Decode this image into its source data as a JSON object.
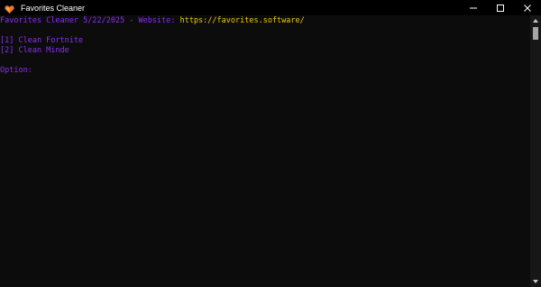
{
  "window": {
    "title": "Favorites Cleaner"
  },
  "console": {
    "header_prefix": "Favorites Cleaner 5/22/2025 - Website: ",
    "header_url": "https://favorites.software/",
    "options": [
      "[1] Clean Fortnite",
      "[2] Clean Minde"
    ],
    "prompt": "Option:"
  },
  "colors": {
    "background": "#0c0c0c",
    "text": "#8b2ff0",
    "url": "#f2c811",
    "titlebar": "#000000"
  },
  "icons": {
    "app": "heart-shield-icon",
    "minimize": "minimize-icon",
    "maximize": "maximize-icon",
    "close": "close-icon"
  }
}
